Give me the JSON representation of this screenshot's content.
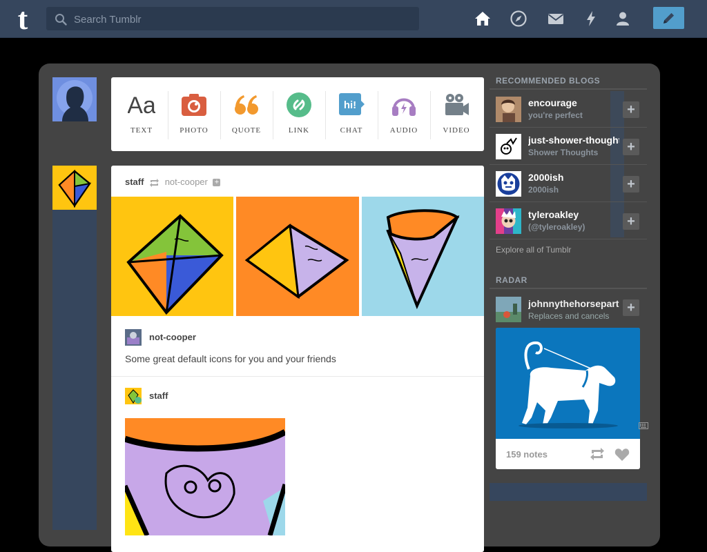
{
  "header": {
    "logo": "t",
    "search": {
      "placeholder": "Search Tumblr",
      "value": ""
    },
    "nav_icons": [
      "home-icon",
      "explore-icon",
      "inbox-icon",
      "activity-icon",
      "account-icon"
    ],
    "compose_icon": "pencil-icon",
    "colors": {
      "bar": "#36465d",
      "search_bg": "#2b3a4f",
      "compose": "#529ecc"
    }
  },
  "post_types": [
    {
      "label": "TEXT",
      "icon": "text-icon",
      "glyph": "Aa",
      "color": "#444444"
    },
    {
      "label": "PHOTO",
      "icon": "camera-icon",
      "color": "#d95e40"
    },
    {
      "label": "QUOTE",
      "icon": "quote-icon",
      "color": "#f2992e"
    },
    {
      "label": "LINK",
      "icon": "link-icon",
      "color": "#56bc8a"
    },
    {
      "label": "CHAT",
      "icon": "chat-icon",
      "glyph": "hi!",
      "color": "#529ecc"
    },
    {
      "label": "AUDIO",
      "icon": "headphones-icon",
      "color": "#a77dc2"
    },
    {
      "label": "VIDEO",
      "icon": "video-camera-icon",
      "color": "#748089"
    }
  ],
  "post": {
    "author": "staff",
    "reblogged_from": "not-cooper",
    "trail": [
      {
        "user": "not-cooper",
        "text": "Some great default icons for you and your friends"
      },
      {
        "user": "staff"
      }
    ]
  },
  "recommended": {
    "heading": "RECOMMENDED BLOGS",
    "blogs": [
      {
        "name": "encourage",
        "subtitle": "you're perfect",
        "plus": "+"
      },
      {
        "name": "just-shower-thoughts",
        "subtitle": "Shower Thoughts",
        "plus": "+"
      },
      {
        "name": "2000ish",
        "subtitle": "2000ish",
        "plus": "+"
      },
      {
        "name": "tyleroakley",
        "subtitle": "(@tyleroakley)",
        "plus": "+"
      }
    ],
    "explore": "Explore all of Tumblr"
  },
  "radar": {
    "heading": "RADAR",
    "name": "johnnythehorsepart",
    "subtitle": "Replaces and cancels",
    "plus": "+",
    "notes": "159 notes"
  }
}
